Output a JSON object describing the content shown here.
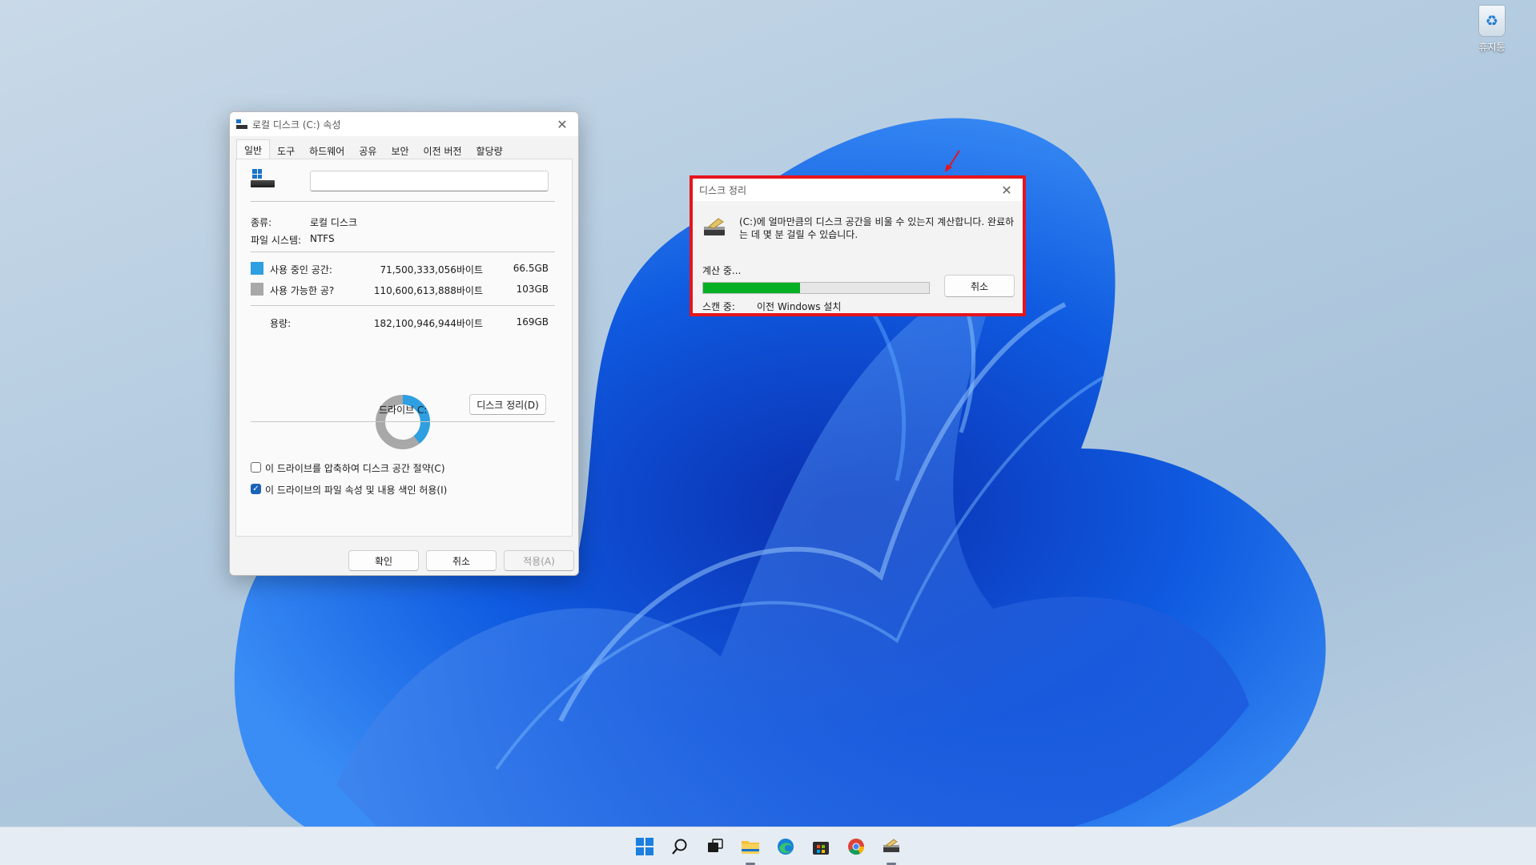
{
  "desktop": {
    "recycle_bin_label": "휴지통"
  },
  "properties": {
    "title": "로컬 디스크 (C:) 속성",
    "tabs": [
      "일반",
      "도구",
      "하드웨어",
      "공유",
      "보안",
      "이전 버전",
      "할당량"
    ],
    "active_tab": "일반",
    "drive_name_value": "",
    "type_label": "종류:",
    "type_value": "로컬 디스크",
    "fs_label": "파일 시스템:",
    "fs_value": "NTFS",
    "used_label": "사용 중인 공간:",
    "used_bytes": "71,500,333,056바이트",
    "used_size": "66.5GB",
    "free_label": "사용 가능한 공?",
    "free_bytes": "110,600,613,888바이트",
    "free_size": "103GB",
    "capacity_label": "용량:",
    "capacity_bytes": "182,100,946,944바이트",
    "capacity_size": "169GB",
    "drive_label": "드라이브 C:",
    "cleanup_button": "디스크 정리(D)",
    "compress_checkbox": "이 드라이브를 압축하여 디스크 공간 절약(C)",
    "compress_checked": false,
    "index_checkbox": "이 드라이브의 파일 속성 및 내용 색인 허용(I)",
    "index_checked": true,
    "ok_button": "확인",
    "cancel_button": "취소",
    "apply_button": "적용(A)",
    "colors": {
      "used": "#2e9fe0",
      "free": "#a8a8a8"
    },
    "used_fraction": 0.393
  },
  "cleanup": {
    "title": "디스크 정리",
    "message": "(C:)에 얼마만큼의 디스크 공간을 비울 수 있는지 계산합니다. 완료하는 데 몇 분 걸릴 수 있습니다.",
    "status": "계산 중...",
    "progress_fraction": 0.43,
    "cancel_button": "취소",
    "scan_label": "스캔 중:",
    "scan_value": "이전 Windows 설치",
    "colors": {
      "highlight_border": "#e5141d",
      "progress": "#06b025"
    }
  },
  "taskbar": {
    "icons": [
      "start-icon",
      "search-icon",
      "task-view-icon",
      "file-explorer-icon",
      "edge-icon",
      "store-icon",
      "chrome-icon",
      "disk-cleanup-icon"
    ]
  }
}
